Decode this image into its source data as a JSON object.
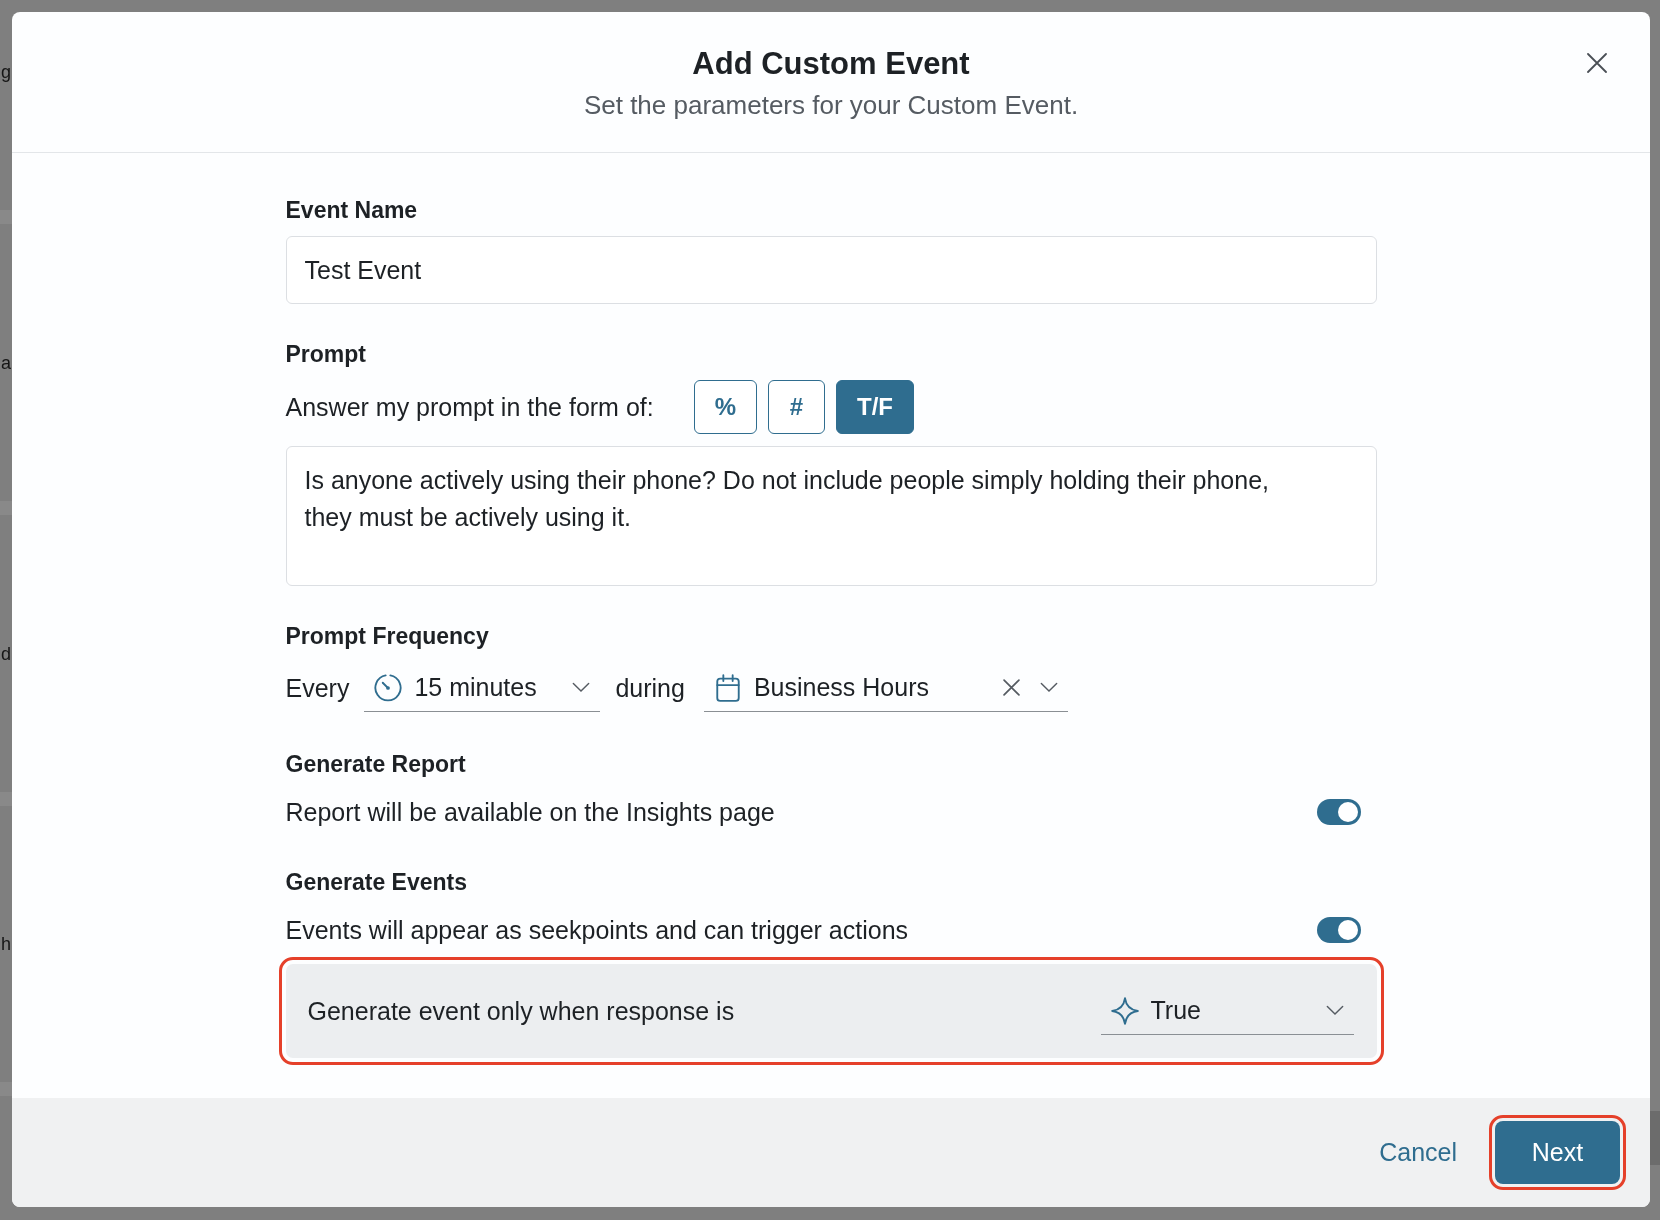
{
  "backdrop": {
    "text_fragments": [
      "g",
      "a",
      "d",
      "h"
    ]
  },
  "dialog": {
    "title": "Add Custom Event",
    "subtitle": "Set the parameters for your Custom Event."
  },
  "event_name": {
    "label": "Event Name",
    "value": "Test Event"
  },
  "prompt": {
    "label": "Prompt",
    "format_label": "Answer my prompt in the form of:",
    "formats": [
      {
        "label": "%",
        "selected": false
      },
      {
        "label": "#",
        "selected": false
      },
      {
        "label": "T/F",
        "selected": true
      }
    ],
    "value": "Is anyone actively using their phone? Do not include people simply holding their phone, they must be actively using it."
  },
  "frequency": {
    "label": "Prompt Frequency",
    "every_label": "Every",
    "interval": {
      "value": "15 minutes"
    },
    "during_label": "during",
    "schedule": {
      "value": "Business Hours",
      "clearable": true
    }
  },
  "settings": [
    {
      "title": "Generate Report",
      "description": "Report will be available on the Insights page",
      "on": true
    },
    {
      "title": "Generate Events",
      "description": "Events will appear as seekpoints and can trigger actions",
      "on": true,
      "condition": {
        "label": "Generate event only when response is",
        "value": "True",
        "highlighted": true
      }
    }
  ],
  "footer": {
    "buttons": [
      {
        "label": "Cancel",
        "kind": "link",
        "highlighted": false
      },
      {
        "label": "Next",
        "kind": "primary",
        "highlighted": true
      }
    ]
  }
}
